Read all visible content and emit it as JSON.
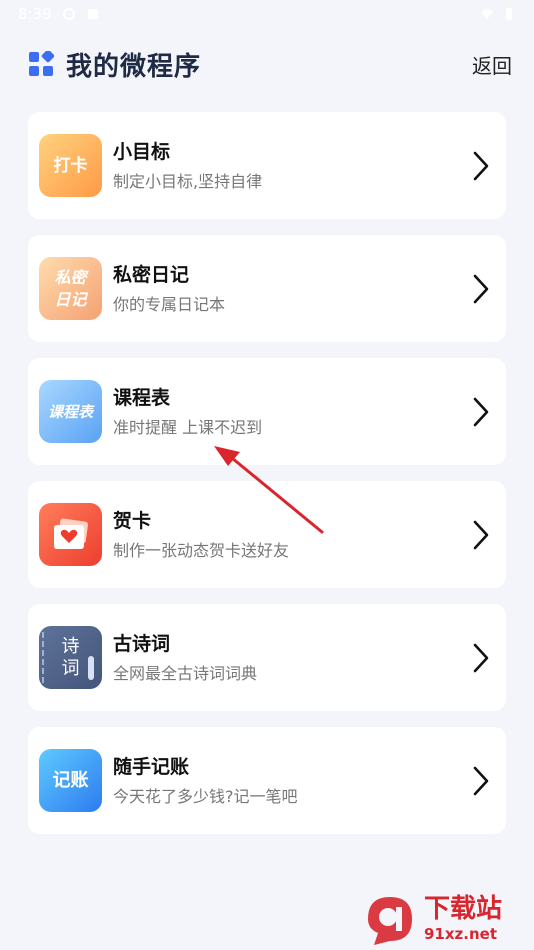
{
  "status_bar": {
    "time": "8:39"
  },
  "header": {
    "title": "我的微程序",
    "back_label": "返回"
  },
  "apps": [
    {
      "title": "小目标",
      "subtitle": "制定小目标,坚持自律",
      "icon_text": "打卡",
      "icon": "punch-card-icon",
      "gradient": [
        "#ffd07a",
        "#ff9f4a"
      ]
    },
    {
      "title": "私密日记",
      "subtitle": "你的专属日记本",
      "icon_text": "私密日记",
      "icon": "diary-icon",
      "gradient": [
        "#ffd9a6",
        "#f7a775"
      ]
    },
    {
      "title": "课程表",
      "subtitle": "准时提醒 上课不迟到",
      "icon_text": "课程表",
      "icon": "schedule-icon",
      "gradient": [
        "#9dd2ff",
        "#5aa5f5"
      ]
    },
    {
      "title": "贺卡",
      "subtitle": "制作一张动态贺卡送好友",
      "icon_text": "",
      "icon": "greeting-card-icon",
      "gradient": [
        "#ff7a5a",
        "#f0402f"
      ]
    },
    {
      "title": "古诗词",
      "subtitle": "全网最全古诗词词典",
      "icon_text": "诗词",
      "icon": "poetry-book-icon",
      "gradient": [
        "#5b6f96",
        "#445577"
      ]
    },
    {
      "title": "随手记账",
      "subtitle": "今天花了多少钱?记一笔吧",
      "icon_text": "记账",
      "icon": "bookkeeping-icon",
      "gradient": [
        "#55c2ff",
        "#2f7cf0"
      ]
    }
  ],
  "watermark": {
    "main": "下载站",
    "sub": "91xz.net"
  },
  "colors": {
    "accent": "#3d6df0",
    "annotation_arrow": "#d9262c"
  }
}
